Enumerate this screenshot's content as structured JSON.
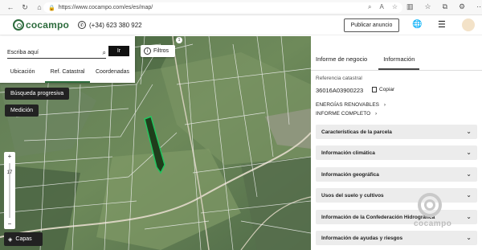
{
  "browser": {
    "url": "https://www.cocampo.com/es/es/map/"
  },
  "header": {
    "logo_text": "cocampo",
    "phone": "(+34) 623 380 922",
    "publish_label": "Publicar anuncio"
  },
  "search": {
    "placeholder": "Escriba aquí",
    "go_label": "Ir",
    "tabs": [
      {
        "label": "Ubicación"
      },
      {
        "label": "Ref. Catastral"
      },
      {
        "label": "Coordenadas"
      }
    ]
  },
  "map": {
    "filters_label": "Filtros",
    "filters_count": "1",
    "progressive_search_label": "Búsqueda progresiva",
    "measurement_label": "Medición",
    "zoom_in": "+",
    "zoom_level": "17",
    "zoom_out": "−",
    "layers_label": "Capas"
  },
  "panel": {
    "tabs": [
      {
        "label": "Informe de negocio"
      },
      {
        "label": "Información"
      }
    ],
    "ref_label": "Referencia catastral",
    "ref_value": "36016A03900223",
    "copy_label": "Copiar",
    "energies_label": "ENERGÍAS RENOVABLES",
    "report_label": "INFORME COMPLETO",
    "accordion": [
      {
        "label": "Características de la parcela"
      },
      {
        "label": "Información climática"
      },
      {
        "label": "Información geográfica"
      },
      {
        "label": "Usos del suelo y cultivos"
      },
      {
        "label": "Información de la Confederación Hidrográfica"
      },
      {
        "label": "Información de ayudas y riesgos"
      }
    ],
    "watermark": "cocampo"
  },
  "colors": {
    "brand": "#2c6b3c",
    "parcel_highlight": "#22c55e"
  }
}
